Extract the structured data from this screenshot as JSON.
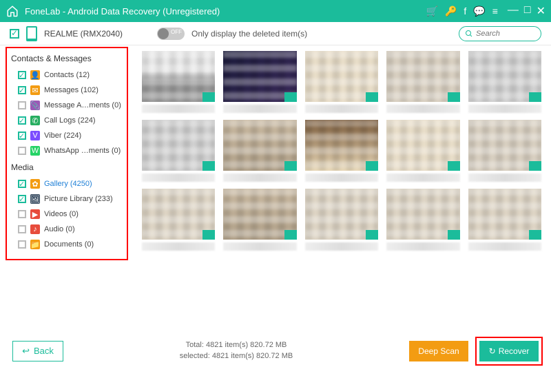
{
  "titlebar": {
    "title": "FoneLab - Android Data Recovery (Unregistered)"
  },
  "topbar": {
    "device": "REALME (RMX2040)",
    "toggle_off": "OFF",
    "toggle_text": "Only display the deleted item(s)",
    "search_placeholder": "Search"
  },
  "sidebar": {
    "cat1": "Contacts & Messages",
    "cat2": "Media",
    "items": [
      {
        "label": "Contacts (12)",
        "checked": true,
        "color": "#f39c12",
        "glyph": "👤"
      },
      {
        "label": "Messages (102)",
        "checked": true,
        "color": "#f39c12",
        "glyph": "✉"
      },
      {
        "label": "Message A…ments (0)",
        "checked": false,
        "color": "#9b59b6",
        "glyph": "📎"
      },
      {
        "label": "Call Logs (224)",
        "checked": true,
        "color": "#27ae60",
        "glyph": "✆"
      },
      {
        "label": "Viber (224)",
        "checked": true,
        "color": "#7c4dff",
        "glyph": "V"
      },
      {
        "label": "WhatsApp …ments (0)",
        "checked": false,
        "color": "#25d366",
        "glyph": "W"
      },
      {
        "label": "Gallery (4250)",
        "checked": true,
        "color": "#f39c12",
        "glyph": "✿",
        "selected": true
      },
      {
        "label": "Picture Library (233)",
        "checked": true,
        "color": "#34495e",
        "glyph": "🖼"
      },
      {
        "label": "Videos (0)",
        "checked": false,
        "color": "#e74c3c",
        "glyph": "▶"
      },
      {
        "label": "Audio (0)",
        "checked": false,
        "color": "#e74c3c",
        "glyph": "♪"
      },
      {
        "label": "Documents (0)",
        "checked": false,
        "color": "#f39c12",
        "glyph": "📁"
      }
    ]
  },
  "stats": {
    "total": "Total: 4821 item(s) 820.72 MB",
    "selected": "selected: 4821 item(s) 820.72 MB"
  },
  "buttons": {
    "back": "Back",
    "deep": "Deep Scan",
    "recover": "Recover"
  }
}
